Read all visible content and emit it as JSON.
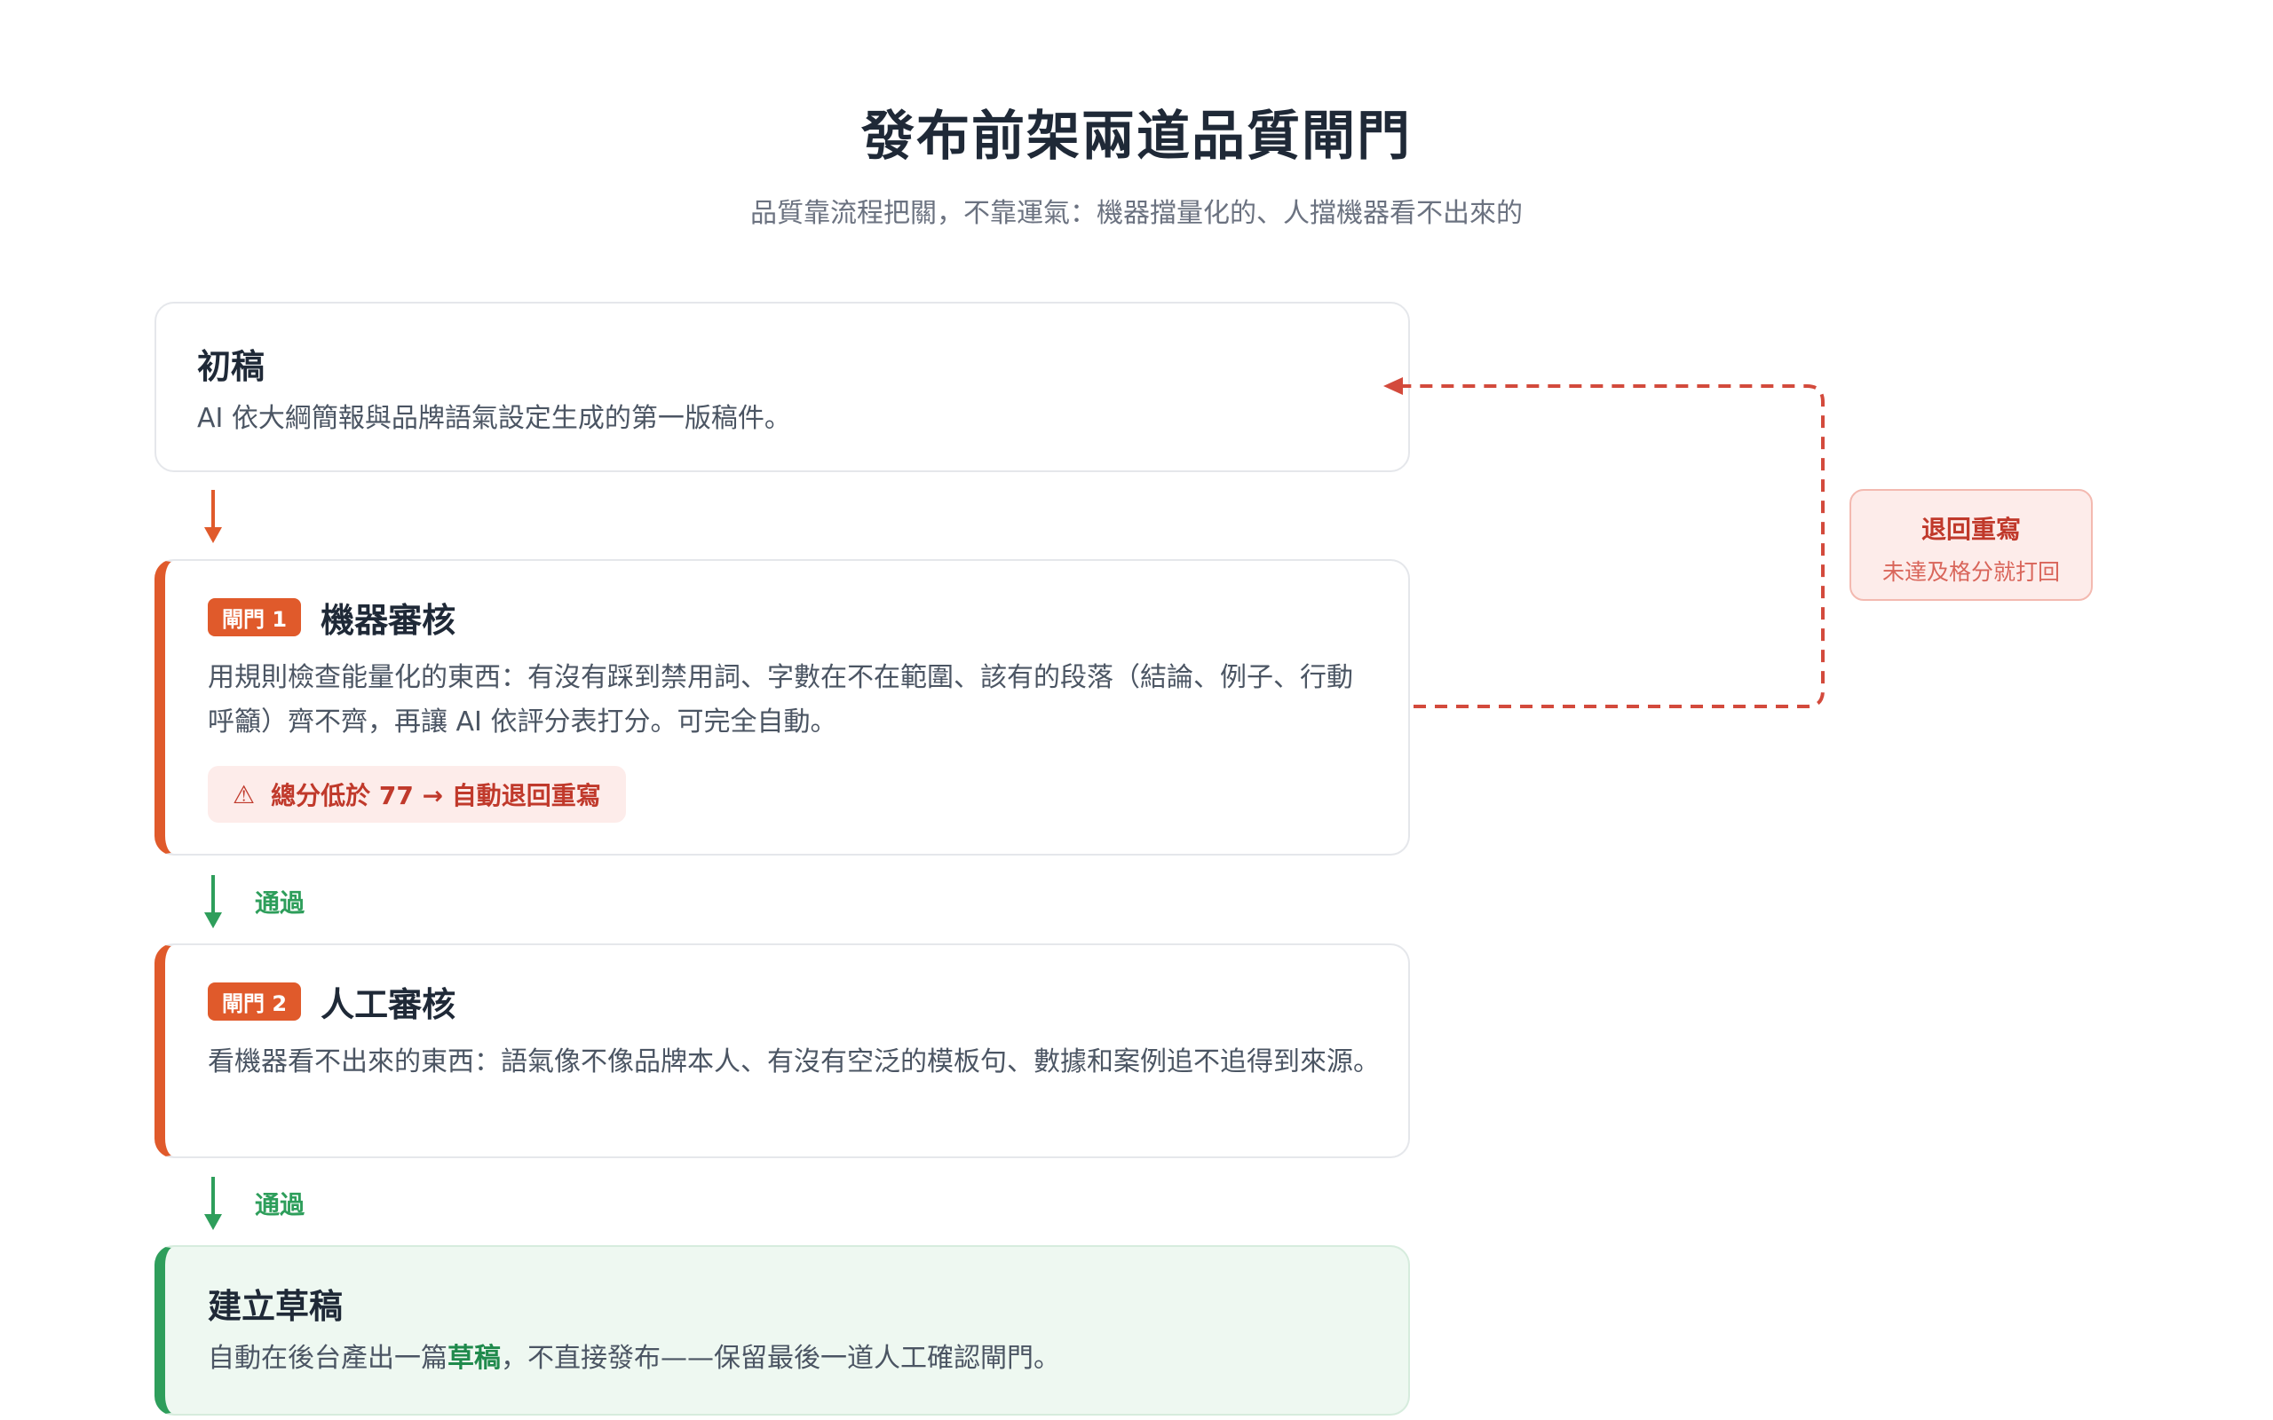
{
  "header": {
    "title": "發布前架兩道品質閘門",
    "subtitle": "品質靠流程把關，不靠運氣：機器擋量化的、人擋機器看不出來的"
  },
  "steps": [
    {
      "title": "初稿",
      "desc": "AI 依大綱簡報與品牌語氣設定生成的第一版稿件。"
    },
    {
      "badge": "閘門 1",
      "title": "機器審核",
      "desc": "用規則檢查能量化的東西：有沒有踩到禁用詞、字數在不在範圍、該有的段落（結論、例子、行動呼籲）齊不齊，再讓 AI 依評分表打分。可完全自動。",
      "warning": "總分低於 77 → 自動退回重寫"
    },
    {
      "badge": "閘門 2",
      "title": "人工審核",
      "desc": "看機器看不出來的東西：語氣像不像品牌本人、有沒有空泛的模板句、數據和案例追不追得到來源。"
    },
    {
      "title": "建立草稿",
      "desc_before": "自動在後台產出一篇",
      "desc_strong": "草稿",
      "desc_after": "，不直接發布——保留最後一道人工確認閘門。"
    }
  ],
  "pass_label": "通過",
  "reject": {
    "title": "退回重寫",
    "subtitle": "未達及格分就打回"
  },
  "colors": {
    "gate_accent": "#e05a2b",
    "pass_green": "#2e9e5b",
    "reject_red": "#c0392b"
  }
}
